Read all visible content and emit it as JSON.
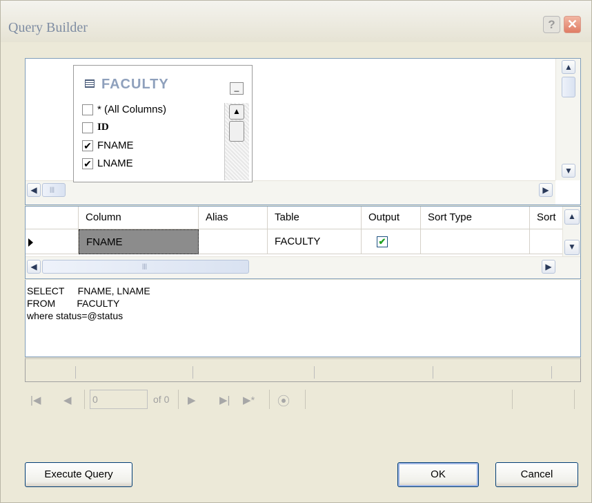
{
  "window": {
    "title": "Query Builder",
    "help_glyph": "?",
    "close_glyph": "✕"
  },
  "diagram": {
    "table_name": "FACULTY",
    "minimize_glyph": "_",
    "columns": [
      {
        "label": "* (All Columns)",
        "checked": false
      },
      {
        "label": "ID",
        "checked": false
      },
      {
        "label": "FNAME",
        "checked": true
      },
      {
        "label": "LNAME",
        "checked": true
      }
    ]
  },
  "grid": {
    "headers": [
      "Column",
      "Alias",
      "Table",
      "Output",
      "Sort Type",
      "Sort"
    ],
    "rows": [
      {
        "column": "FNAME",
        "alias": "",
        "table": "FACULTY",
        "output": true,
        "sort_type": "",
        "sort": ""
      }
    ]
  },
  "sql": {
    "lines": [
      "SELECT     FNAME, LNAME",
      "FROM        FACULTY",
      "where status=@status"
    ]
  },
  "navigator": {
    "position": "0",
    "of_label": "of 0"
  },
  "buttons": {
    "execute": "Execute Query",
    "ok": "OK",
    "cancel": "Cancel"
  },
  "scroll_glyphs": {
    "up": "▲",
    "down": "▼",
    "left": "◀",
    "right": "▶",
    "grip": "|||"
  }
}
